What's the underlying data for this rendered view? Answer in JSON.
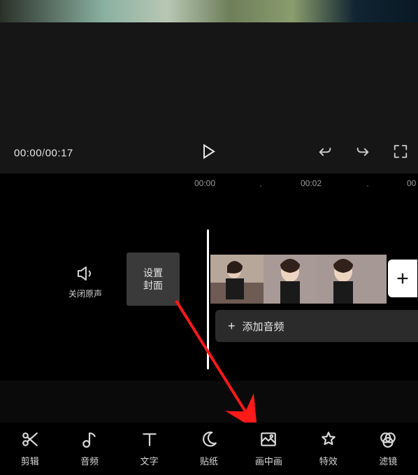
{
  "preview": {
    "time_current": "00:00",
    "time_separator": "/",
    "time_total": "00:17"
  },
  "ruler": {
    "t0": "00:00",
    "t1": "00:02",
    "t2": "00"
  },
  "timeline": {
    "mute_label": "关闭原声",
    "cover_line1": "设置",
    "cover_line2": "封面",
    "add_audio_label": "添加音频"
  },
  "toolbar": {
    "edit": "剪辑",
    "audio": "音频",
    "text": "文字",
    "sticker": "贴纸",
    "pip": "画中画",
    "effects": "特效",
    "filter": "滤镜"
  },
  "icons": {
    "play": "play-icon",
    "undo": "undo-icon",
    "redo": "redo-icon",
    "fullscreen": "fullscreen-icon",
    "speaker": "speaker-icon",
    "plus": "plus-icon",
    "scissors": "scissors-icon",
    "note": "music-note-icon",
    "text": "text-icon",
    "moon": "sticker-icon",
    "pip": "picture-in-picture-icon",
    "star": "effects-icon",
    "filter": "filter-icon"
  }
}
